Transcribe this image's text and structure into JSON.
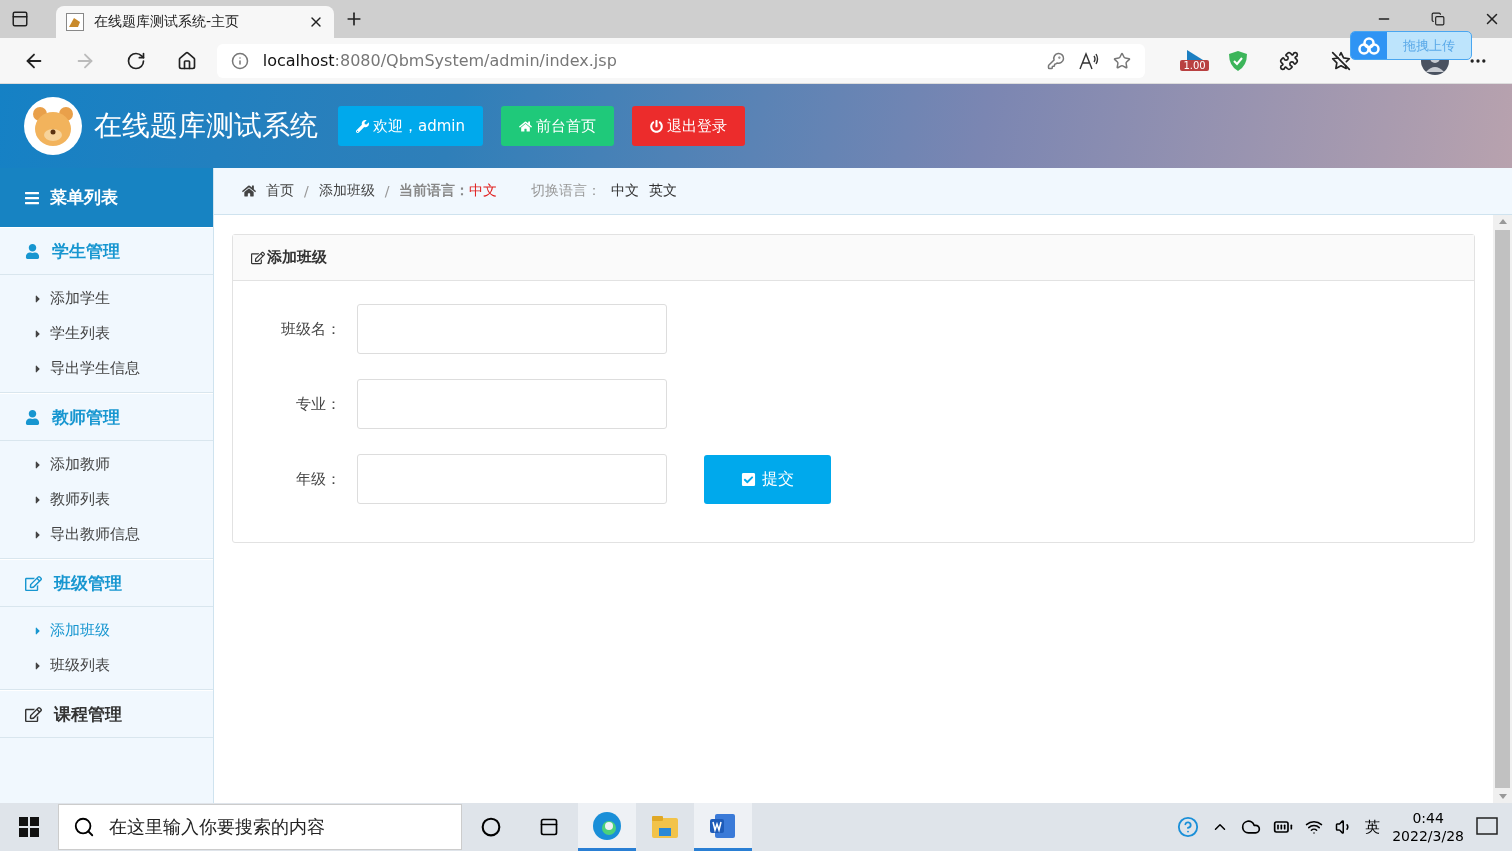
{
  "browser": {
    "tab_title": "在线题库测试系统-主页",
    "url_host": "localhost",
    "url_path": ":8080/QbmSystem/admin/index.jsp",
    "zoom_badge": "1.00",
    "upload_widget": "拖拽上传"
  },
  "header": {
    "title": "在线题库测试系统",
    "buttons": [
      {
        "kind": "welcome",
        "label": "欢迎，admin"
      },
      {
        "kind": "home",
        "label": "前台首页"
      },
      {
        "kind": "logout",
        "label": "退出登录"
      }
    ]
  },
  "sidebar": {
    "title": "菜单列表",
    "groups": [
      {
        "label": "学生管理",
        "kind": "user",
        "expanded": true,
        "items": [
          {
            "label": "添加学生",
            "selected": false
          },
          {
            "label": "学生列表",
            "selected": false
          },
          {
            "label": "导出学生信息",
            "selected": false
          }
        ]
      },
      {
        "label": "教师管理",
        "kind": "user",
        "expanded": true,
        "items": [
          {
            "label": "添加教师",
            "selected": false
          },
          {
            "label": "教师列表",
            "selected": false
          },
          {
            "label": "导出教师信息",
            "selected": false
          }
        ]
      },
      {
        "label": "班级管理",
        "kind": "edit",
        "expanded": true,
        "items": [
          {
            "label": "添加班级",
            "selected": true
          },
          {
            "label": "班级列表",
            "selected": false
          }
        ]
      },
      {
        "label": "课程管理",
        "kind": "edit",
        "expanded": false
      }
    ]
  },
  "breadcrumb": {
    "items": [
      "首页",
      "添加班级"
    ],
    "separator": "/",
    "current_language_label": "当前语言：",
    "current_language": "中文",
    "switch_label": "切换语言：",
    "languages": [
      "中文",
      "英文"
    ]
  },
  "panel": {
    "title": "添加班级",
    "fields": [
      {
        "label": "班级名："
      },
      {
        "label": "专业："
      },
      {
        "label": "年级："
      }
    ],
    "submit": "提交"
  },
  "taskbar": {
    "search_placeholder": "在这里输入你要搜索的内容",
    "ime": "英",
    "time": "0:44",
    "date": "2022/3/28"
  }
}
